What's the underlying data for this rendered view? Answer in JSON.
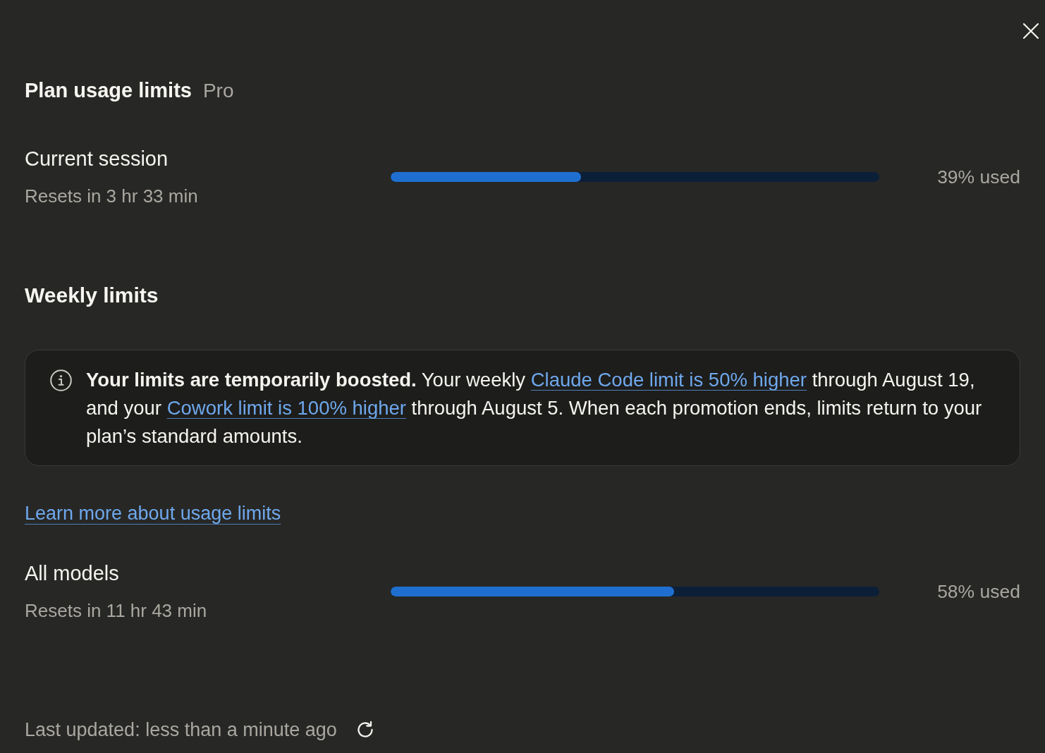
{
  "title": "Plan usage limits",
  "plan": "Pro",
  "current_session": {
    "label": "Current session",
    "resets": "Resets in 3 hr 33 min",
    "level": 0.39,
    "reading": "39% used"
  },
  "weekly_limits": {
    "title": "Weekly limits",
    "notice": {
      "segments": [
        {
          "kind": "text",
          "text": "**Your limits are temporarily boosted.** Your weekly "
        },
        {
          "kind": "link",
          "text": "Claude Code limit is 50% higher"
        },
        {
          "kind": "text",
          "text": " through August 19, and your "
        },
        {
          "kind": "link",
          "text": "Cowork limit is 100% higher"
        },
        {
          "kind": "text",
          "text": " through August 5. When each promotion ends, limits return to your plan’s standard amounts."
        }
      ]
    },
    "learn_more_link": "Learn more about usage limits",
    "models": [
      {
        "label": "All models",
        "resets": "Resets in 11 hr 43 min",
        "level": 0.58,
        "reading": "58% used"
      }
    ]
  },
  "footer": {
    "last_updated": "Last updated: less than a minute ago"
  }
}
